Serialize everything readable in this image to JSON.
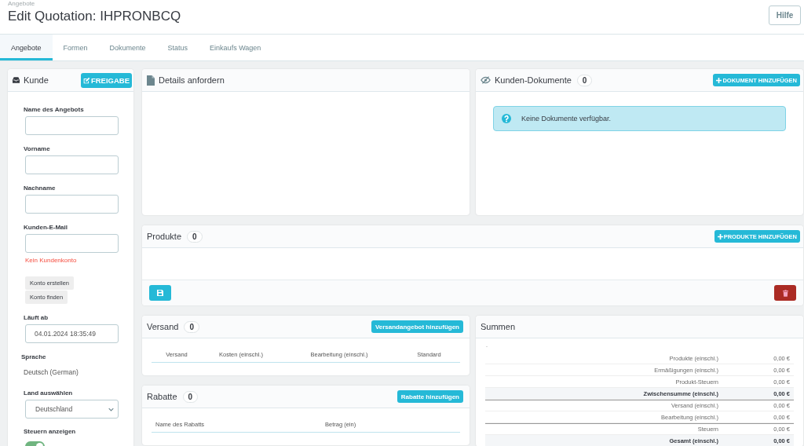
{
  "breadcrumb": "Angebote",
  "title": "Edit Quotation: IHPRONBCQ",
  "help_button": "Hilfe",
  "tabs": [
    {
      "label": "Angebote",
      "selected": true
    },
    {
      "label": "Formen",
      "selected": false
    },
    {
      "label": "Dokumente",
      "selected": false
    },
    {
      "label": "Status",
      "selected": false
    },
    {
      "label": "Einkaufs Wagen",
      "selected": false
    }
  ],
  "customer_panel": {
    "title": "Kunde",
    "button": "FREIGABE",
    "items": [
      {
        "kind": "input",
        "label": "Name des Angebots"
      },
      {
        "kind": "input",
        "label": "Vorname"
      },
      {
        "kind": "input",
        "label": "Nachname"
      },
      {
        "kind": "input",
        "label": "Kunden-E-Mail"
      },
      {
        "kind": "error",
        "text": "Kein Kundenkonto"
      },
      {
        "kind": "buttons",
        "buttons": [
          "Konto erstellen",
          "Konto finden"
        ]
      },
      {
        "kind": "input",
        "label": "Läuft ab",
        "value": "04.01.2024 18:35:49"
      },
      {
        "kind": "text",
        "label": "Sprache",
        "value": "Deutsch (German)"
      },
      {
        "kind": "select",
        "label": "Land auswählen",
        "value": "Deutschland"
      },
      {
        "kind": "toggle",
        "label": "Steuern anzeigen",
        "on": true
      }
    ]
  },
  "details_panel": {
    "title": "Details anfordern"
  },
  "documents_panel": {
    "title": "Kunden-Dokumente",
    "count": "0",
    "button": "DOKUMENT HINZUFÜGEN",
    "alert": "Keine Dokumente verfügbar."
  },
  "products_panel": {
    "title": "Produkte",
    "count": "0",
    "button": "PRODUKTE HINZUFÜGEN"
  },
  "shipping_panel": {
    "title": "Versand",
    "count": "0",
    "button": "Versandangebot hinzufügen",
    "columns": [
      "Versand",
      "Kosten (einschl.)",
      "Bearbeitung (einschl.)",
      "Standard"
    ]
  },
  "discounts_panel": {
    "title": "Rabatte",
    "count": "0",
    "button": "Rabatte hinzufügen",
    "columns": [
      "Name des Rabatts",
      "Betrag (ein)"
    ]
  },
  "totals_panel": {
    "title": "Summen",
    "note": "-",
    "rows": [
      {
        "kind": "line",
        "label": "Produkte (einschl.)",
        "value": "0,00 €",
        "divider_above": false
      },
      {
        "kind": "line",
        "label": "Ermäßigungen (einschl.)",
        "value": "0,00 €",
        "divider_above": false
      },
      {
        "kind": "line",
        "label": "Produkt-Steuern",
        "value": "0,00 €",
        "divider_above": false
      },
      {
        "kind": "sum",
        "label": "Zwischensumme (einschl.)",
        "value": "0,00 €",
        "divider_above": false
      },
      {
        "kind": "line",
        "label": "Versand (einschl.)",
        "value": "0,00 €",
        "divider_above": true
      },
      {
        "kind": "line",
        "label": "Bearbeitung (einschl.)",
        "value": "0,00 €",
        "divider_above": false
      },
      {
        "kind": "line",
        "label": "Steuern",
        "value": "0,00 €",
        "divider_above": true
      },
      {
        "kind": "sum",
        "label": "Gesamt (einschl.)",
        "value": "0,00 €",
        "divider_above": false
      }
    ]
  }
}
